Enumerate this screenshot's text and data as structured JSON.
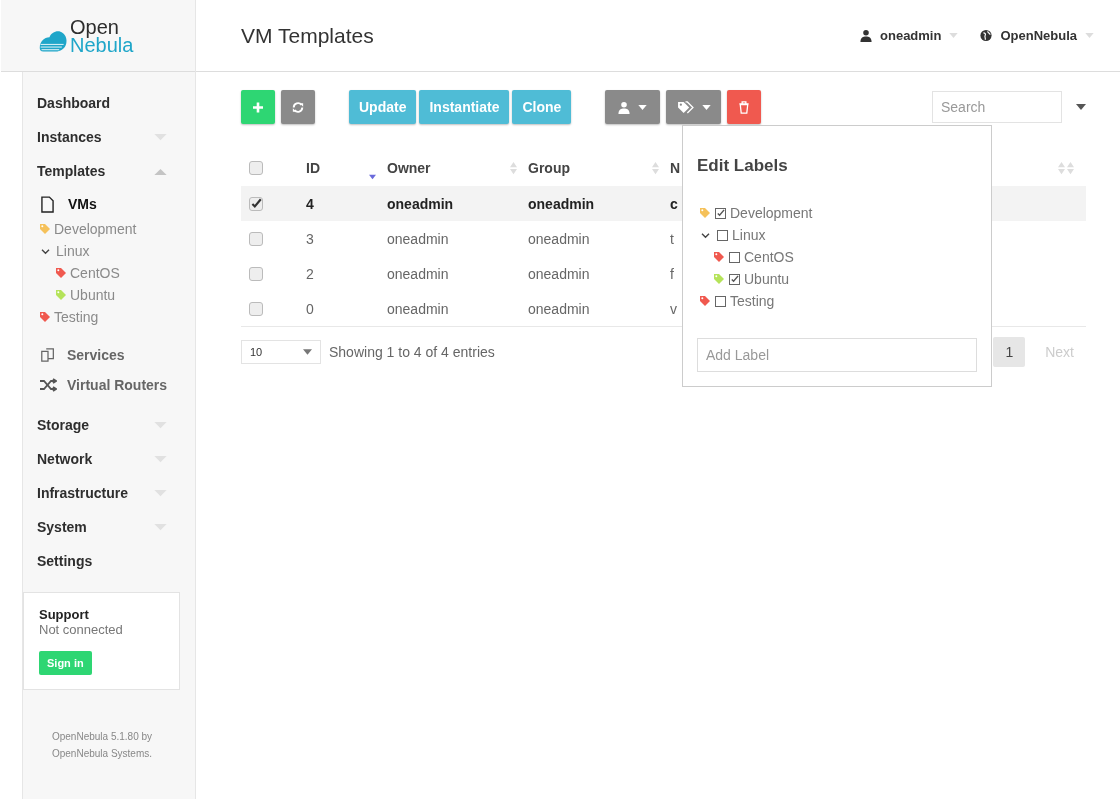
{
  "logo": {
    "line1": "Open",
    "line2": "Nebula"
  },
  "header": {
    "title": "VM Templates",
    "user": "oneadmin",
    "zone": "OpenNebula"
  },
  "sidebar": {
    "items": [
      {
        "label": "Dashboard"
      },
      {
        "label": "Instances",
        "expanded": false
      },
      {
        "label": "Templates",
        "expanded": true,
        "pages": [
          {
            "label": "VMs",
            "selected": true
          }
        ],
        "labels": [
          {
            "label": "Development",
            "color": "#f5c15a"
          },
          {
            "label": "Linux",
            "expanded": true,
            "children": [
              {
                "label": "CentOS",
                "color": "#f0594f"
              },
              {
                "label": "Ubuntu",
                "color": "#b5e35a"
              }
            ]
          },
          {
            "label": "Testing",
            "color": "#f0594f"
          }
        ],
        "links": [
          {
            "label": "Services"
          },
          {
            "label": "Virtual Routers"
          }
        ]
      },
      {
        "label": "Storage",
        "expanded": false
      },
      {
        "label": "Network",
        "expanded": false
      },
      {
        "label": "Infrastructure",
        "expanded": false
      },
      {
        "label": "System",
        "expanded": false
      },
      {
        "label": "Settings"
      }
    ],
    "support": {
      "title": "Support",
      "status": "Not connected",
      "button": "Sign in"
    },
    "footer": "OpenNebula 5.1.80 by OpenNebula Systems."
  },
  "toolbar": {
    "actions": [
      "Update",
      "Instantiate",
      "Clone"
    ],
    "search": {
      "placeholder": "Search"
    }
  },
  "table": {
    "all_selected": false,
    "columns": [
      {
        "label": "ID",
        "sorted": true
      },
      {
        "label": "Owner",
        "sorted": false
      },
      {
        "label": "Group",
        "sorted": false
      },
      {
        "label": "N",
        "sorted": false
      }
    ],
    "rows": [
      {
        "selected": true,
        "id": "4",
        "owner": "oneadmin",
        "group": "oneadmin",
        "name": "c"
      },
      {
        "selected": false,
        "id": "3",
        "owner": "oneadmin",
        "group": "oneadmin",
        "name": "t"
      },
      {
        "selected": false,
        "id": "2",
        "owner": "oneadmin",
        "group": "oneadmin",
        "name": "f"
      },
      {
        "selected": false,
        "id": "0",
        "owner": "oneadmin",
        "group": "oneadmin",
        "name": "v"
      }
    ],
    "page_size": "10",
    "info": "Showing 1 to 4 of 4 entries",
    "pagination": [
      {
        "label": "1",
        "selected": true,
        "disabled": false
      },
      {
        "label": "Next",
        "selected": false,
        "disabled": true
      }
    ]
  },
  "labels_popup": {
    "title": "Edit Labels",
    "labels": [
      {
        "label": "Development",
        "color": "#f5c15a",
        "checked": true
      },
      {
        "label": "Linux",
        "checked": false,
        "expanded": true,
        "children": [
          {
            "label": "CentOS",
            "color": "#f0594f",
            "checked": false
          },
          {
            "label": "Ubuntu",
            "color": "#b5e35a",
            "checked": true
          }
        ]
      },
      {
        "label": "Testing",
        "color": "#f0594f",
        "checked": false
      }
    ],
    "add": {
      "placeholder": "Add Label"
    }
  }
}
